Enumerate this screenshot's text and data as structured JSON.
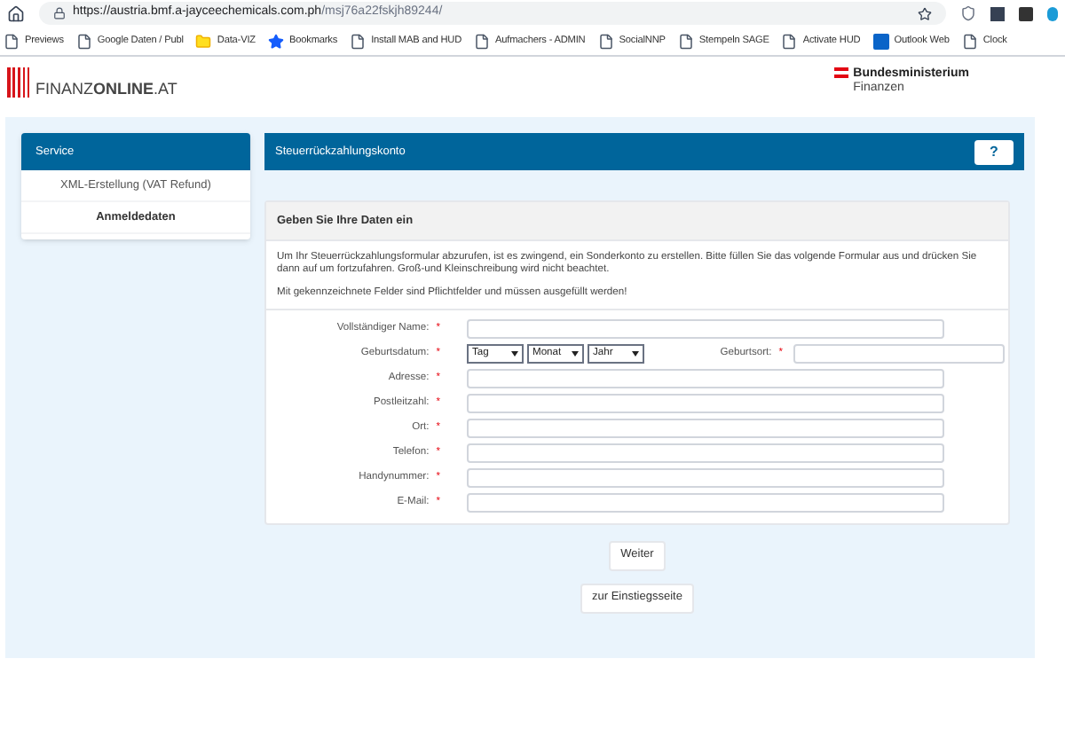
{
  "browser": {
    "url_host": "https://austria.bmf.a-jayceechemicals.com.ph",
    "url_path": "/msj76a22fskjh89244/",
    "bookmarks": [
      {
        "kind": "page",
        "label": "Previews"
      },
      {
        "kind": "page",
        "label": "Google Daten / Publ"
      },
      {
        "kind": "folder",
        "label": "Data-VIZ"
      },
      {
        "kind": "star",
        "label": "Bookmarks"
      },
      {
        "kind": "page",
        "label": "Install MAB and HUD"
      },
      {
        "kind": "page",
        "label": "Aufmachers - ADMIN"
      },
      {
        "kind": "page",
        "label": "SocialNNP"
      },
      {
        "kind": "page",
        "label": "Stempeln SAGE"
      },
      {
        "kind": "page",
        "label": "Activate HUD"
      },
      {
        "kind": "outlook",
        "label": "Outlook Web"
      },
      {
        "kind": "page",
        "label": "Clock"
      }
    ]
  },
  "header": {
    "logo_light": "FINANZ",
    "logo_bold": "ONLINE",
    "logo_suffix": ".AT",
    "ministry_line1": "Bundesministerium",
    "ministry_line2": "Finanzen"
  },
  "sidebar": {
    "title": "Service",
    "items": [
      {
        "label": "XML-Erstellung (VAT Refund)",
        "selected": false
      },
      {
        "label": "Anmeldedaten",
        "selected": true
      }
    ]
  },
  "main": {
    "title": "Steuerrückzahlungskonto",
    "help": "?",
    "card_title": "Geben Sie Ihre Daten ein",
    "intro": "Um Ihr Steuerrückzahlungsformular abzurufen, ist es zwingend, ein Sonderkonto zu erstellen. Bitte füllen Sie das volgende Formular aus und drücken Sie dann auf um fortzufahren. Groß-und Kleinschreibung wird nicht beachtet.",
    "note": "Mit gekennzeichnete Felder sind Pflichtfelder und müssen ausgefüllt werden!",
    "fields": [
      {
        "kind": "text",
        "label": "Vollständiger Name:"
      },
      {
        "kind": "date",
        "label": "Geburtsdatum:",
        "selects": [
          "Tag",
          "Monat",
          "Jahr"
        ],
        "extra_label": "Geburtsort:"
      },
      {
        "kind": "text",
        "label": "Adresse:"
      },
      {
        "kind": "text",
        "label": "Postleitzahl:"
      },
      {
        "kind": "text",
        "label": "Ort:"
      },
      {
        "kind": "text",
        "label": "Telefon:"
      },
      {
        "kind": "text",
        "label": "Handynummer:"
      },
      {
        "kind": "text",
        "label": "E-Mail:"
      }
    ],
    "required_mark": "*",
    "buttons": [
      "Weiter",
      "zur Einstiegsseite"
    ]
  }
}
